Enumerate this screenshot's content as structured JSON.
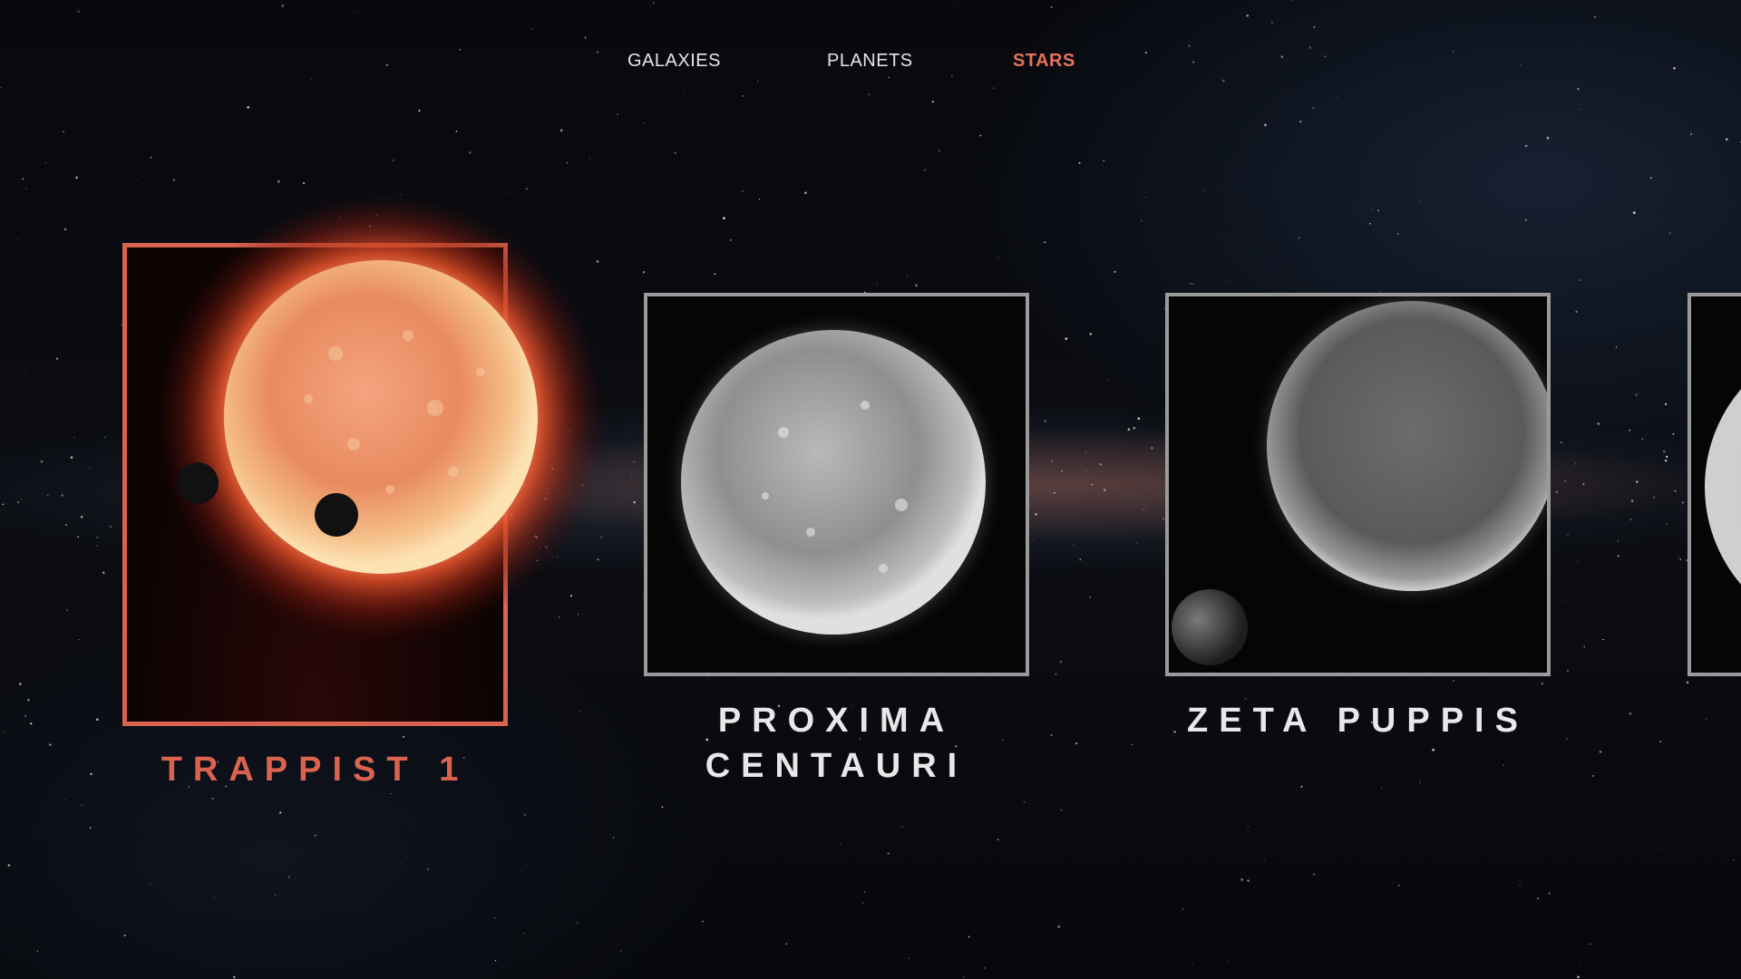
{
  "nav": {
    "items": [
      {
        "label": "GALAXIES",
        "active": false
      },
      {
        "label": "PLANETS",
        "active": false
      },
      {
        "label": "STARS",
        "active": true
      }
    ]
  },
  "cards": [
    {
      "title": "TRAPPIST 1",
      "active": true,
      "image": "red-dwarf-star-with-transiting-planets"
    },
    {
      "title_line1": "PROXIMA",
      "title_line2": "CENTAURI",
      "active": false,
      "image": "grayscale-star"
    },
    {
      "title": "ZETA PUPPIS",
      "active": false,
      "image": "grayscale-star-with-planet"
    },
    {
      "title": "",
      "active": false,
      "image": "grayscale-star-partial"
    }
  ],
  "colors": {
    "accent": "#d9634f",
    "nav_active": "#e8725c",
    "nav_inactive": "#e6e6e6",
    "inactive_border": "#9a9a9a",
    "background": "#05070b"
  }
}
